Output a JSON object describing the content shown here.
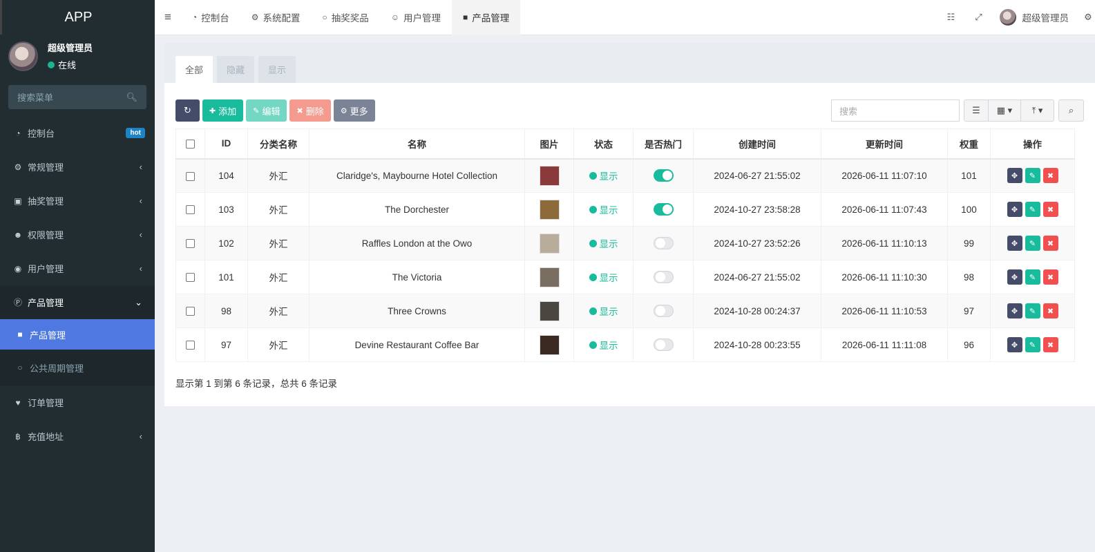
{
  "app": {
    "title": "APP"
  },
  "user": {
    "name": "超级管理员",
    "status": "在线"
  },
  "sidebar": {
    "search_placeholder": "搜索菜单",
    "items": [
      {
        "label": "控制台",
        "icon": "dashboard-icon",
        "badge": "hot"
      },
      {
        "label": "常规管理",
        "icon": "cogs-icon"
      },
      {
        "label": "抽奖管理",
        "icon": "gift-icon"
      },
      {
        "label": "权限管理",
        "icon": "group-icon"
      },
      {
        "label": "用户管理",
        "icon": "user-circle-icon"
      },
      {
        "label": "产品管理",
        "icon": "product-icon",
        "open": true
      },
      {
        "label": "订单管理",
        "icon": "heartbeat-icon"
      },
      {
        "label": "充值地址",
        "icon": "bitcoin-icon"
      }
    ],
    "sub_items": [
      {
        "label": "产品管理",
        "active": true
      },
      {
        "label": "公共周期管理",
        "active": false
      }
    ]
  },
  "topnav": {
    "tabs": [
      {
        "label": "控制台",
        "icon": "dashboard-icon"
      },
      {
        "label": "系统配置",
        "icon": "gear-icon"
      },
      {
        "label": "抽奖奖品",
        "icon": "circle-icon"
      },
      {
        "label": "用户管理",
        "icon": "user-icon"
      },
      {
        "label": "产品管理",
        "icon": "shopping-bag-icon",
        "active": true
      }
    ],
    "user_name": "超级管理员"
  },
  "content": {
    "tabs": [
      {
        "label": "全部",
        "active": true
      },
      {
        "label": "隐藏"
      },
      {
        "label": "显示"
      }
    ],
    "toolbar": {
      "add": "添加",
      "edit": "编辑",
      "delete": "删除",
      "more": "更多"
    },
    "search_placeholder": "搜索",
    "columns": [
      "ID",
      "分类名称",
      "名称",
      "图片",
      "状态",
      "是否热门",
      "创建时间",
      "更新时间",
      "权重",
      "操作"
    ],
    "rows": [
      {
        "id": "104",
        "category": "外汇",
        "name": "Claridge's, Maybourne Hotel Collection",
        "status": "显示",
        "hot": true,
        "created": "2024-06-27 21:55:02",
        "updated": "2026-06-11 11:07:10",
        "weight": "101",
        "thumb_color": "#8a3a3a"
      },
      {
        "id": "103",
        "category": "外汇",
        "name": "The Dorchester",
        "status": "显示",
        "hot": true,
        "created": "2024-10-27 23:58:28",
        "updated": "2026-06-11 11:07:43",
        "weight": "100",
        "thumb_color": "#8c6a3a"
      },
      {
        "id": "102",
        "category": "外汇",
        "name": "Raffles London at the Owo",
        "status": "显示",
        "hot": false,
        "created": "2024-10-27 23:52:26",
        "updated": "2026-06-11 11:10:13",
        "weight": "99",
        "thumb_color": "#b8ad9a"
      },
      {
        "id": "101",
        "category": "外汇",
        "name": "The Victoria",
        "status": "显示",
        "hot": false,
        "created": "2024-06-27 21:55:02",
        "updated": "2026-06-11 11:10:30",
        "weight": "98",
        "thumb_color": "#7a6e62"
      },
      {
        "id": "98",
        "category": "外汇",
        "name": "Three Crowns",
        "status": "显示",
        "hot": false,
        "created": "2024-10-28 00:24:37",
        "updated": "2026-06-11 11:10:53",
        "weight": "97",
        "thumb_color": "#4a4640"
      },
      {
        "id": "97",
        "category": "外汇",
        "name": "Devine Restaurant Coffee Bar",
        "status": "显示",
        "hot": false,
        "created": "2024-10-28 00:23:55",
        "updated": "2026-06-11 11:11:08",
        "weight": "96",
        "thumb_color": "#3a2a22"
      }
    ],
    "summary": "显示第 1 到第 6 条记录，总共 6 条记录"
  }
}
